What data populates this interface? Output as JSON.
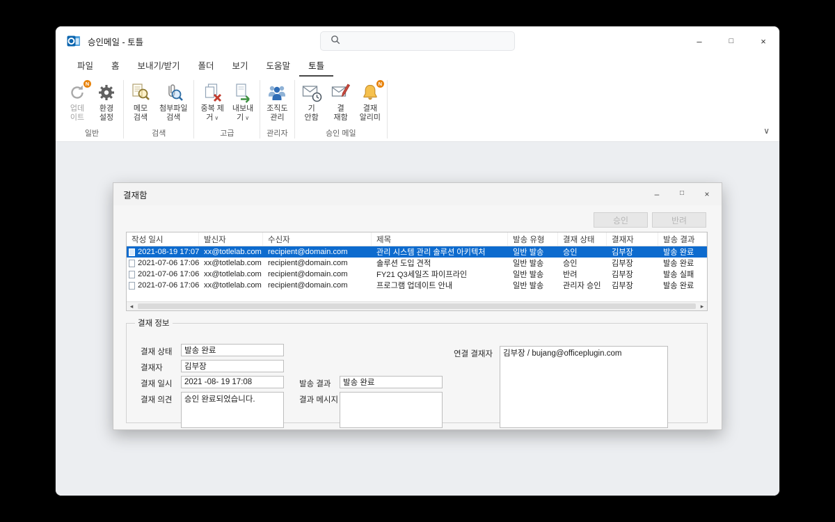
{
  "colors": {
    "selection_blue": "#0d6bce",
    "badge_orange": "#e8830c",
    "workspace_gray": "#eceef1"
  },
  "icons": {
    "badge_n": "N",
    "minimize": "–",
    "maximize": "□",
    "close": "×",
    "chevron_down": "∨",
    "scroll_left": "◂",
    "scroll_right": "▸"
  },
  "window": {
    "title": "승인메일 - 토틀"
  },
  "tabs": [
    {
      "label": "파일"
    },
    {
      "label": "홈"
    },
    {
      "label": "보내기/받기"
    },
    {
      "label": "폴더"
    },
    {
      "label": "보기"
    },
    {
      "label": "도움말"
    },
    {
      "label": "토틀"
    }
  ],
  "ribbon": {
    "groups": [
      {
        "label": "일반",
        "buttons": [
          {
            "line1": "업데",
            "line2": "이트"
          },
          {
            "line1": "환경",
            "line2": "설정"
          }
        ]
      },
      {
        "label": "검색",
        "buttons": [
          {
            "line1": "메모",
            "line2": "검색"
          },
          {
            "line1": "첨부파일",
            "line2": "검색"
          }
        ]
      },
      {
        "label": "고급",
        "buttons": [
          {
            "line1": "중복 제",
            "line2": "거"
          },
          {
            "line1": "내보내",
            "line2": "기"
          }
        ]
      },
      {
        "label": "관리자",
        "buttons": [
          {
            "line1": "조직도",
            "line2": "관리"
          }
        ]
      },
      {
        "label": "승인 메일",
        "buttons": [
          {
            "line1": "기",
            "line2": "안함"
          },
          {
            "line1": "결",
            "line2": "재함"
          },
          {
            "line1": "결재",
            "line2": "알리미"
          }
        ]
      }
    ]
  },
  "dialog": {
    "title": "결재함",
    "approve_label": "승인",
    "reject_label": "반려",
    "table": {
      "columns": [
        "작성 일시",
        "발신자",
        "수신자",
        "제목",
        "발송 유형",
        "결재 상태",
        "결재자",
        "발송 결과"
      ],
      "rows": [
        {
          "date": "2021-08-19 17:07",
          "sender": "xx@totlelab.com",
          "recipient": "recipient@domain.com",
          "subject": "관리 시스템 관리 솔루션 아키텍처",
          "send_type": "일반 발송",
          "status": "승인",
          "approver": "김부장",
          "result": "발송 완료",
          "selected": true
        },
        {
          "date": "2021-07-06 17:06",
          "sender": "xx@totlelab.com",
          "recipient": "recipient@domain.com",
          "subject": "솔루션 도입 견적",
          "send_type": "일반 발송",
          "status": "승인",
          "approver": "김부장",
          "result": "발송 완료",
          "selected": false
        },
        {
          "date": "2021-07-06 17:06",
          "sender": "xx@totlelab.com",
          "recipient": "recipient@domain.com",
          "subject": "FY21 Q3세일즈 파이프라인",
          "send_type": "일반 발송",
          "status": "반려",
          "approver": "김부장",
          "result": "발송 실패",
          "selected": false
        },
        {
          "date": "2021-07-06 17:06",
          "sender": "xx@totlelab.com",
          "recipient": "recipient@domain.com",
          "subject": "프로그램 업데이트 안내",
          "send_type": "일반 발송",
          "status": "관리자 승인",
          "approver": "김부장",
          "result": "발송 완료",
          "selected": false
        }
      ]
    },
    "info": {
      "legend": "결재 정보",
      "status_label": "결재 상태",
      "status_value": "발송 완료",
      "approver_label": "결재자",
      "approver_value": "김부장",
      "datetime_label": "결재 일시",
      "datetime_value": "2021 -08- 19 17:08",
      "comment_label": "결재 의견",
      "comment_value": "승인 완료되었습니다.",
      "send_result_label": "발송 결과",
      "send_result_value": "발송 완료",
      "result_msg_label": "결과 메시지",
      "result_msg_value": "",
      "linked_label": "연결 결재자",
      "linked_value": "김부장 / bujang@officeplugin.com"
    }
  }
}
